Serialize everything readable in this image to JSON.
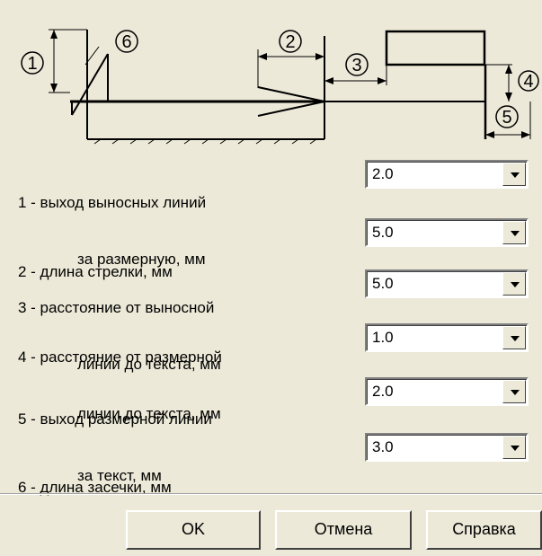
{
  "diagram": {
    "callouts": [
      "1",
      "2",
      "3",
      "4",
      "5",
      "6"
    ]
  },
  "settings": [
    {
      "line1": "1 - выход выносных линий",
      "line2": "за размерную, мм",
      "value": "2.0"
    },
    {
      "line1": "2 - длина стрелки, мм",
      "line2": "",
      "value": "5.0"
    },
    {
      "line1": "3 - расстояние от выносной",
      "line2": "линии до текста, мм",
      "value": "5.0"
    },
    {
      "line1": "4 - расстояние от размерной",
      "line2": "линии до текста, мм",
      "value": "1.0"
    },
    {
      "line1": "5 - выход размерной линии",
      "line2": "за текст, мм",
      "value": "2.0"
    },
    {
      "line1": "6 - длина засечки, мм",
      "line2": "",
      "value": "3.0"
    }
  ],
  "buttons": {
    "ok": "OK",
    "cancel": "Отмена",
    "help": "Справка"
  }
}
